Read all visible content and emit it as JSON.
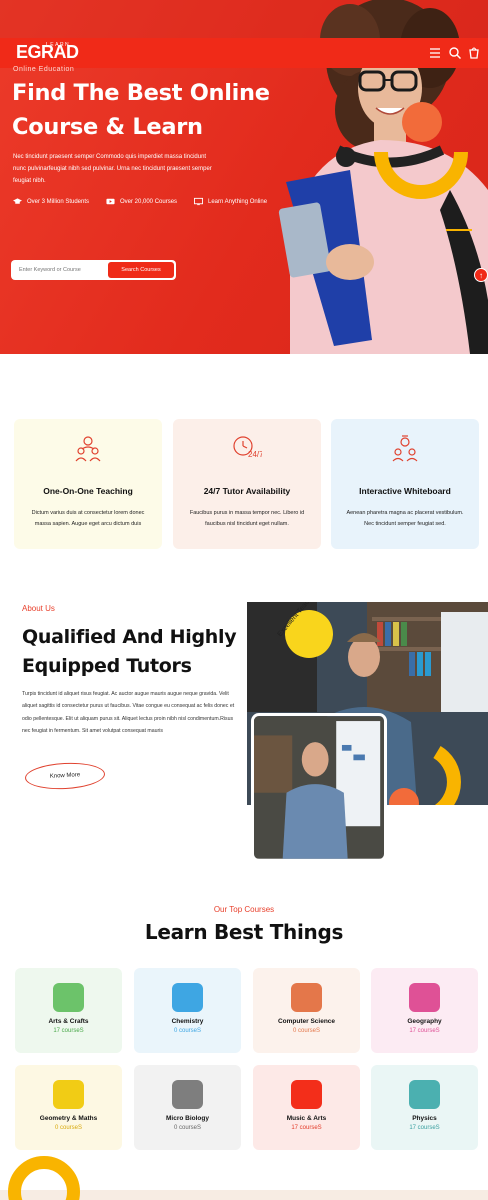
{
  "header": {
    "logo_main": "EGRAD",
    "logo_small": "LEARN",
    "subtitle": "Online Education"
  },
  "hero": {
    "title": "Find The Best Online Course & Learn",
    "description": "Nec tincidunt praesent semper Commodo quis imperdiet massa tincidunt nunc pulvinarfeugiat nibh sed pulvinar. Urna nec tincidunt praesent semper feugiat nibh.",
    "stats": [
      {
        "icon": "graduation-cap-icon",
        "label": "Over 3 Million Students"
      },
      {
        "icon": "video-icon",
        "label": "Over 20,000 Courses"
      },
      {
        "icon": "monitor-icon",
        "label": "Learn Anything Online"
      }
    ],
    "search": {
      "placeholder": "Enter Keyword or Course",
      "button": "Search Courses"
    }
  },
  "features": [
    {
      "icon": "teacher-icon",
      "title": "One-On-One Teaching",
      "text": "Dictum varius duis at consectetur lorem donec massa sapien. Augue eget arcu dictum duis",
      "bg": "#fdfbe8"
    },
    {
      "icon": "clock-24-icon",
      "title": "24/7 Tutor Availability",
      "text": "Faucibus purus in massa tempor nec. Libero id faucibus nisl tincidunt eget nullam.",
      "bg": "#fcefe9"
    },
    {
      "icon": "whiteboard-icon",
      "title": "Interactive Whiteboard",
      "text": "Aenean pharetra magna ac placerat vestibulum. Nec tincidunt semper feugiat sed.",
      "bg": "#e8f3fb"
    }
  ],
  "about": {
    "tag": "About Us",
    "title": "Qualified And Highly Equipped Tutors",
    "text": "Turpis tincidunt id aliquet risus feugiat. Ac auctor augue mauris augue neque gravida. Velit aliquet sagittis id consectetur purus ut faucibus. Vitae congue eu consequat ac felis donec et odio pellentesque. Elit ut aliquam purus sit. Aliquet lectus proin nibh nisl condimentum.Risus nec feugiat in fermentum. Sit amet volutpat consequat mauris",
    "button": "Know More",
    "badge_text": "Excellent Teaching"
  },
  "courses": {
    "tag": "Our Top Courses",
    "title": "Learn Best Things",
    "items": [
      {
        "name": "Arts & Crafts",
        "count": "17 courseS",
        "color": "#6cc36a",
        "bg": "#eef8ee",
        "count_color": "#4aa84a"
      },
      {
        "name": "Chemistry",
        "count": "0 courseS",
        "color": "#3ea6e3",
        "bg": "#eaf5fb",
        "count_color": "#3ea6e3"
      },
      {
        "name": "Computer Science",
        "count": "0 courseS",
        "color": "#e4774a",
        "bg": "#fcf2ec",
        "count_color": "#e4774a"
      },
      {
        "name": "Geography",
        "count": "17 courseS",
        "color": "#df5196",
        "bg": "#fcebf3",
        "count_color": "#df5196"
      },
      {
        "name": "Geometry & Maths",
        "count": "0 courseS",
        "color": "#f1cc15",
        "bg": "#fdf8e3",
        "count_color": "#d8a90a"
      },
      {
        "name": "Micro Biology",
        "count": "0 courseS",
        "color": "#7e7e7e",
        "bg": "#f2f2f2",
        "count_color": "#666666"
      },
      {
        "name": "Music & Arts",
        "count": "17 courseS",
        "color": "#f32e1a",
        "bg": "#fde9e7",
        "count_color": "#e33a28"
      },
      {
        "name": "Physics",
        "count": "17 courseS",
        "color": "#4bb0b0",
        "bg": "#eaf6f5",
        "count_color": "#3aa0a0"
      }
    ]
  }
}
